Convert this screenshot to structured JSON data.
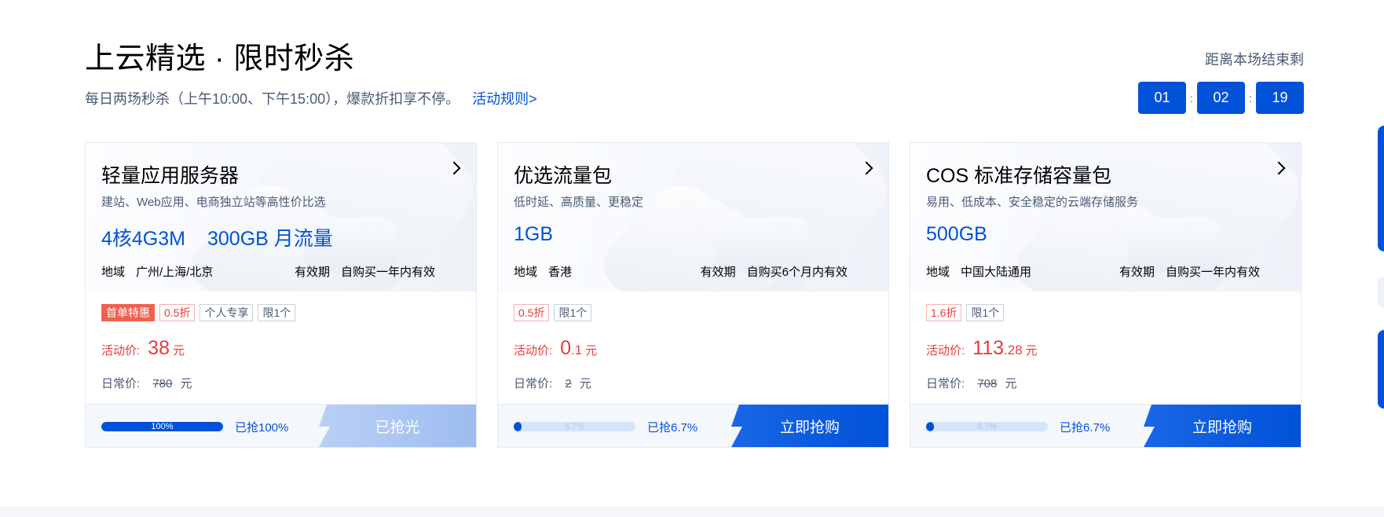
{
  "header": {
    "title": "上云精选 · 限时秒杀",
    "subtitle": "每日两场秒杀（上午10:00、下午15:00），爆款折扣享不停。",
    "rules_link": "活动规则>"
  },
  "countdown": {
    "label": "距离本场结束剩",
    "hours": "01",
    "minutes": "02",
    "seconds": "19",
    "separator": ":"
  },
  "cards": [
    {
      "title": "轻量应用服务器",
      "desc": "建站、Web应用、电商独立站等高性价比选",
      "spec": [
        "4核4G3M",
        "300GB 月流量"
      ],
      "region_label": "地域",
      "region": "广州/上海/北京",
      "validity_label": "有效期",
      "validity": "自购买一年内有效",
      "first_tag": "首单特惠",
      "tags": [
        "0.5折",
        "个人专享",
        "限1个"
      ],
      "price_label": "活动价:",
      "price_int": "38",
      "price_dec": "",
      "price_unit": "元",
      "regular_label": "日常价:",
      "regular_price": "780",
      "regular_unit": "元",
      "progress": 100,
      "progress_text": "100%",
      "grab_text": "已抢100%",
      "button": "已抢光",
      "soldout": true
    },
    {
      "title": "优选流量包",
      "desc": "低时延、高质量、更稳定",
      "spec": [
        "1GB"
      ],
      "region_label": "地域",
      "region": "香港",
      "validity_label": "有效期",
      "validity": "自购买6个月内有效",
      "first_tag": "",
      "tags": [
        "0.5折",
        "限1个"
      ],
      "price_label": "活动价:",
      "price_int": "0",
      "price_dec": ".1",
      "price_unit": "元",
      "regular_label": "日常价:",
      "regular_price": "2",
      "regular_unit": "元",
      "progress": 6.7,
      "progress_text": "6.7%",
      "grab_text": "已抢6.7%",
      "button": "立即抢购",
      "soldout": false
    },
    {
      "title": "COS 标准存储容量包",
      "desc": "易用、低成本、安全稳定的云端存储服务",
      "spec": [
        "500GB"
      ],
      "region_label": "地域",
      "region": "中国大陆通用",
      "validity_label": "有效期",
      "validity": "自购买一年内有效",
      "first_tag": "",
      "tags": [
        "1.6折",
        "限1个"
      ],
      "price_label": "活动价:",
      "price_int": "113",
      "price_dec": ".28",
      "price_unit": "元",
      "regular_label": "日常价:",
      "regular_price": "708",
      "regular_unit": "元",
      "progress": 6.7,
      "progress_text": "6.7%",
      "grab_text": "已抢6.7%",
      "button": "立即抢购",
      "soldout": false
    }
  ],
  "colors": {
    "brand": "#0052d9",
    "price": "#e63c3c",
    "first_tag": "#f0604f"
  }
}
